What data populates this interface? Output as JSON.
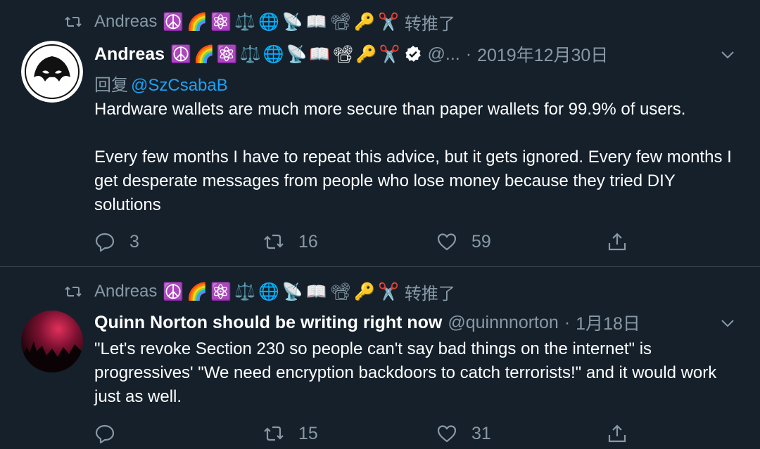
{
  "colors": {
    "background": "#15202b",
    "text_primary": "#ffffff",
    "text_secondary": "#8899a6",
    "link": "#1da1f2",
    "divider": "#38444d"
  },
  "tweets": [
    {
      "retweet_by": "Andreas",
      "retweet_emojis": [
        "☮️",
        "🌈",
        "⚛️",
        "⚖️",
        "🌐",
        "📡",
        "📖",
        "📽",
        "🔑",
        "✂️"
      ],
      "retweet_label": "转推了",
      "display_name": "Andreas",
      "name_emojis": [
        "☮️",
        "🌈",
        "⚛️",
        "⚖️",
        "🌐",
        "📡",
        "📖",
        "📽",
        "🔑",
        "✂️"
      ],
      "verified": true,
      "handle": "@...",
      "separator": "·",
      "date": "2019年12月30日",
      "reply_label": "回复",
      "reply_to": "@SzCsabaB",
      "text_paragraphs": [
        "Hardware wallets are much more secure than paper wallets for 99.9% of users.",
        "Every few months I have to repeat this advice, but it gets ignored. Every few months I get desperate messages from people who lose money because they tried DIY solutions"
      ],
      "replies": "3",
      "retweets": "16",
      "likes": "59",
      "icons": [
        "retweet-icon",
        "reply-icon",
        "like-icon",
        "share-icon",
        "chevron-down-icon",
        "verified-badge-icon"
      ]
    },
    {
      "retweet_by": "Andreas",
      "retweet_emojis": [
        "☮️",
        "🌈",
        "⚛️",
        "⚖️",
        "🌐",
        "📡",
        "📖",
        "📽",
        "🔑",
        "✂️"
      ],
      "retweet_label": "转推了",
      "display_name": "Quinn Norton should be writing right now",
      "handle": "@quinnnorton",
      "separator": "·",
      "date": "1月18日",
      "text_paragraphs": [
        "\"Let's revoke Section 230 so people can't say bad things on the internet\" is progressives' \"We need encryption backdoors to catch terrorists!\" and it would work just as well."
      ],
      "replies": "",
      "retweets": "15",
      "likes": "31",
      "icons": [
        "retweet-icon",
        "reply-icon",
        "like-icon",
        "share-icon",
        "chevron-down-icon"
      ]
    }
  ]
}
